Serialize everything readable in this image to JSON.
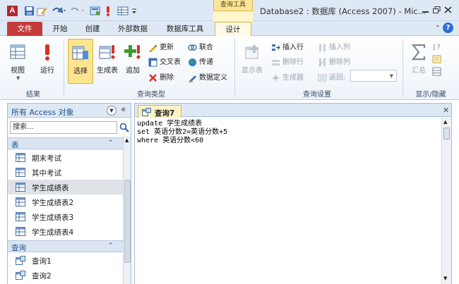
{
  "app": {
    "logo_letter": "A"
  },
  "title_bar": {
    "contextual_tab": "查询工具",
    "window_title": "Database2 : 数据库 (Access 2007) - Mic..."
  },
  "ribbon_tabs": [
    "文件",
    "开始",
    "创建",
    "外部数据",
    "数据库工具",
    "设计"
  ],
  "help_label": "?",
  "ribbon": {
    "groups": [
      "结果",
      "查询类型",
      "查询设置",
      "显示/隐藏"
    ],
    "results": {
      "view": "视图",
      "run": "运行"
    },
    "query_type": {
      "select": "选择",
      "make_table": "生成表",
      "append": "追加",
      "update": "更新",
      "crosstab": "交叉表",
      "delete": "删除",
      "union": "联合",
      "pass_through": "传递",
      "data_definition": "数据定义"
    },
    "query_setup": {
      "show_table": "显示表",
      "insert_rows": "插入行",
      "delete_rows": "删除行",
      "builder": "生成器",
      "insert_columns": "插入列",
      "delete_columns": "删除列",
      "return": "返回:"
    },
    "show_hide": {
      "totals": "汇总"
    }
  },
  "nav_pane": {
    "title": "所有 Access 对象",
    "search_placeholder": "搜索...",
    "sections": [
      {
        "title": "表",
        "items": [
          "期末考试",
          "其中考试",
          "学生成绩表",
          "学生成绩表2",
          "学生成绩表3",
          "学生成绩表4"
        ]
      },
      {
        "title": "查询",
        "items": [
          "查询1",
          "查询2"
        ]
      }
    ],
    "active_item": "学生成绩表"
  },
  "document": {
    "tab_title": "查询7",
    "sql_lines": [
      "update 学生成绩表",
      "set 英语分数2=英语分数+5",
      "where 英语分数<60"
    ]
  },
  "colors": {
    "file_tab": "#c43b3b",
    "contextual_tab": "#fbe59a",
    "selected_button": "#fde58f",
    "nav_header_text": "#1f4e8c",
    "title_bar_bg": "#dfe9f5"
  },
  "icons": {
    "qat": [
      "save-icon",
      "undo-icon",
      "redo-icon",
      "sheet-icon",
      "exclamation-icon",
      "table-icon"
    ],
    "window": [
      "minimize-icon",
      "restore-icon",
      "close-icon"
    ]
  }
}
